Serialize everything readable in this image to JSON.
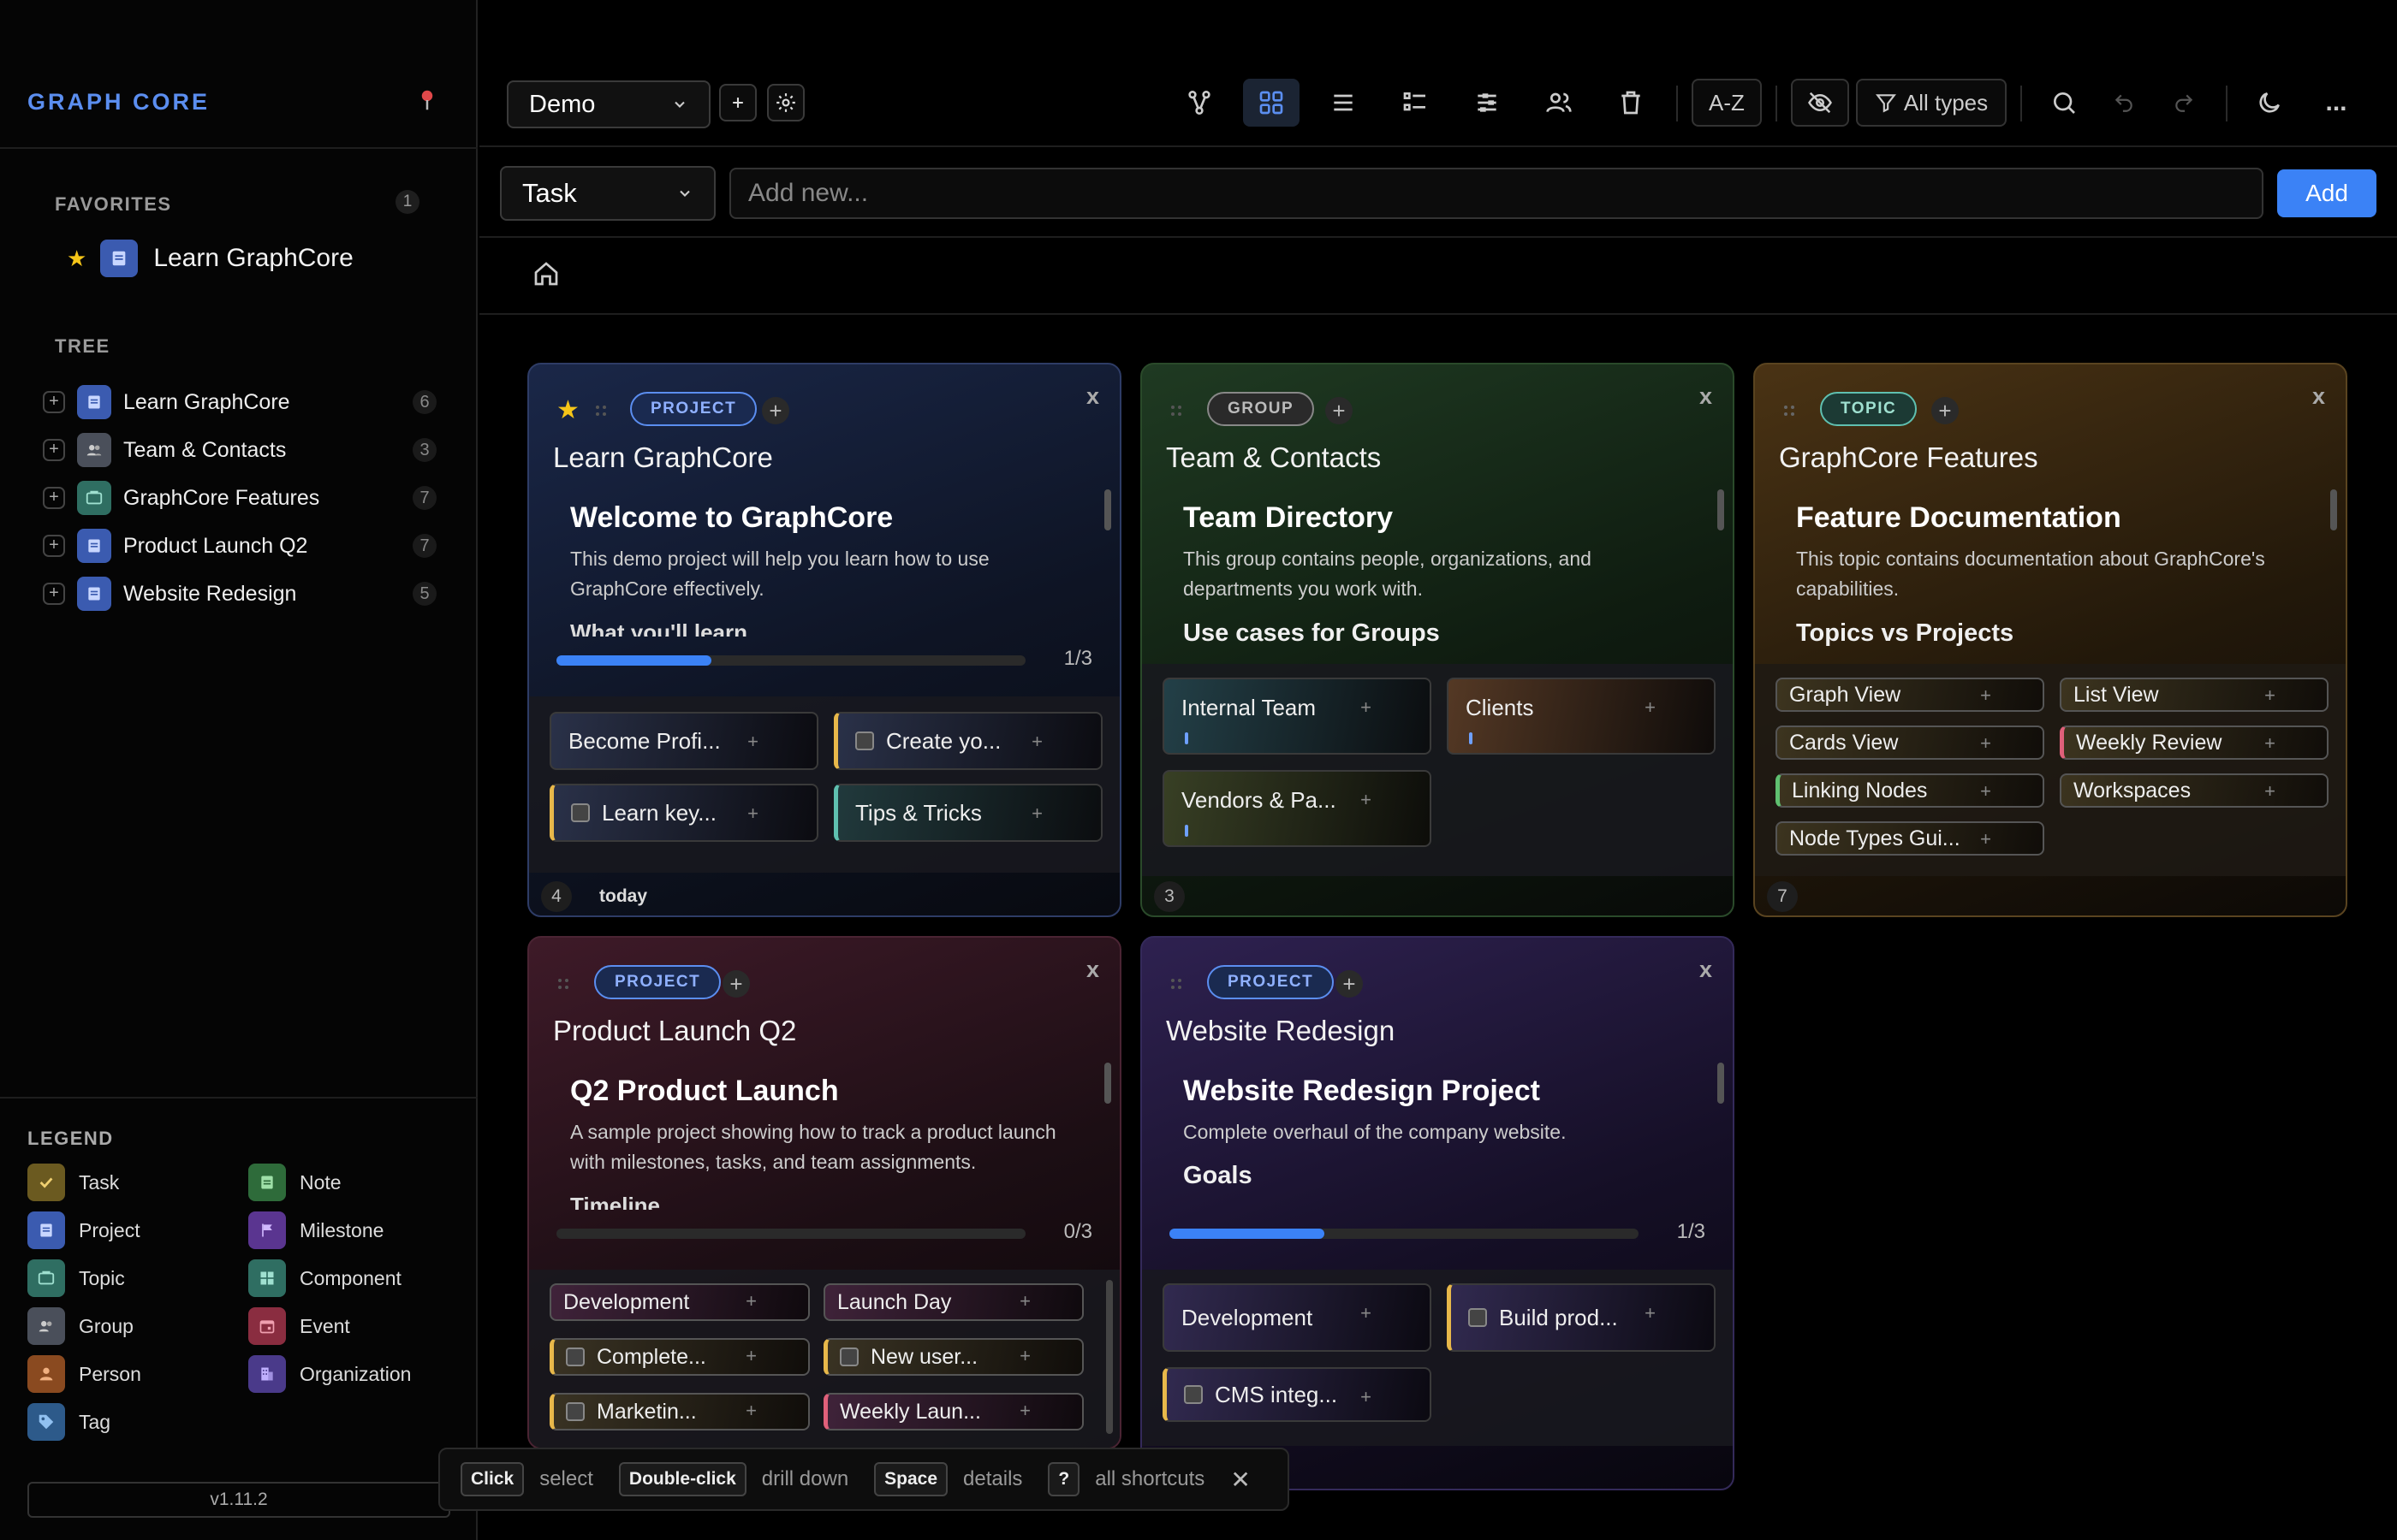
{
  "app": {
    "brand": "GRAPH CORE",
    "version": "v1.11.2"
  },
  "sidebar": {
    "favorites_label": "FAVORITES",
    "favorites_count": "1",
    "favorites": [
      {
        "label": "Learn GraphCore",
        "icon": "project-icon"
      }
    ],
    "tree_label": "TREE",
    "tree": [
      {
        "label": "Learn GraphCore",
        "count": "6",
        "icon": "project-icon",
        "color": "#3b5bb0"
      },
      {
        "label": "Team & Contacts",
        "count": "3",
        "icon": "group-icon",
        "color": "#4a4f5a"
      },
      {
        "label": "GraphCore Features",
        "count": "7",
        "icon": "topic-icon",
        "color": "#2f6e62"
      },
      {
        "label": "Product Launch Q2",
        "count": "7",
        "icon": "project-icon",
        "color": "#3b5bb0"
      },
      {
        "label": "Website Redesign",
        "count": "5",
        "icon": "project-icon",
        "color": "#3b5bb0"
      }
    ],
    "legend_label": "LEGEND",
    "legend": [
      {
        "label": "Task",
        "icon": "task-icon",
        "color": "#6b5a20"
      },
      {
        "label": "Note",
        "icon": "note-icon",
        "color": "#2e6b3a"
      },
      {
        "label": "Project",
        "icon": "project-icon",
        "color": "#3b5bb0"
      },
      {
        "label": "Milestone",
        "icon": "milestone-icon",
        "color": "#5a3590"
      },
      {
        "label": "Topic",
        "icon": "topic-icon",
        "color": "#2f6e62"
      },
      {
        "label": "Component",
        "icon": "component-icon",
        "color": "#2f6e62"
      },
      {
        "label": "Group",
        "icon": "group-icon",
        "color": "#4a4f5a"
      },
      {
        "label": "Event",
        "icon": "event-icon",
        "color": "#8a2d40"
      },
      {
        "label": "Person",
        "icon": "person-icon",
        "color": "#8a4a20"
      },
      {
        "label": "Organization",
        "icon": "organization-icon",
        "color": "#4a3a8a"
      },
      {
        "label": "Tag",
        "icon": "tag-icon",
        "color": "#2d5a8a"
      }
    ]
  },
  "toolbar": {
    "workspace": "Demo",
    "sort_label": "A-Z",
    "filter_label": "All types",
    "more_label": "..."
  },
  "addbar": {
    "type": "Task",
    "placeholder": "Add new...",
    "add_label": "Add"
  },
  "cards": [
    {
      "type": "PROJECT",
      "title": "Learn GraphCore",
      "heading": "Welcome to GraphCore",
      "desc": "This demo project will help you learn how to use GraphCore effectively.",
      "subheading": "What you'll learn",
      "progress": 0.33,
      "progress_text": "1/3",
      "children": [
        "Become Profi...",
        "Create yo...",
        "Learn key...",
        "Tips & Tricks"
      ],
      "footer_count": "4",
      "footer_text": "today"
    },
    {
      "type": "GROUP",
      "title": "Team & Contacts",
      "heading": "Team Directory",
      "desc": "This group contains people, organizations, and departments you work with.",
      "subheading": "Use cases for Groups",
      "children": [
        "Internal Team",
        "Clients",
        "Vendors & Pa..."
      ],
      "footer_count": "3"
    },
    {
      "type": "TOPIC",
      "title": "GraphCore Features",
      "heading": "Feature Documentation",
      "desc": "This topic contains documentation about GraphCore's capabilities.",
      "subheading": "Topics vs Projects",
      "children": [
        "Graph View",
        "List View",
        "Cards View",
        "Weekly Review",
        "Linking Nodes",
        "Workspaces",
        "Node Types Gui..."
      ],
      "footer_count": "7"
    },
    {
      "type": "PROJECT",
      "title": "Product Launch Q2",
      "heading": "Q2 Product Launch",
      "desc": "A sample project showing how to track a product launch with milestones, tasks, and team assignments.",
      "subheading": "Timeline",
      "progress": 0,
      "progress_text": "0/3",
      "children": [
        "Development",
        "Launch Day",
        "Complete...",
        "New user...",
        "Marketin...",
        "Weekly Laun..."
      ]
    },
    {
      "type": "PROJECT",
      "title": "Website Redesign",
      "heading": "Website Redesign Project",
      "desc": "Complete overhaul of the company website.",
      "subheading": "Goals",
      "progress": 0.33,
      "progress_text": "1/3",
      "children": [
        "Development",
        "Build prod...",
        "CMS integ..."
      ]
    }
  ],
  "hints": [
    {
      "key": "Click",
      "text": "select"
    },
    {
      "key": "Double-click",
      "text": "drill down"
    },
    {
      "key": "Space",
      "text": "details"
    },
    {
      "key": "?",
      "text": "all shortcuts"
    }
  ]
}
